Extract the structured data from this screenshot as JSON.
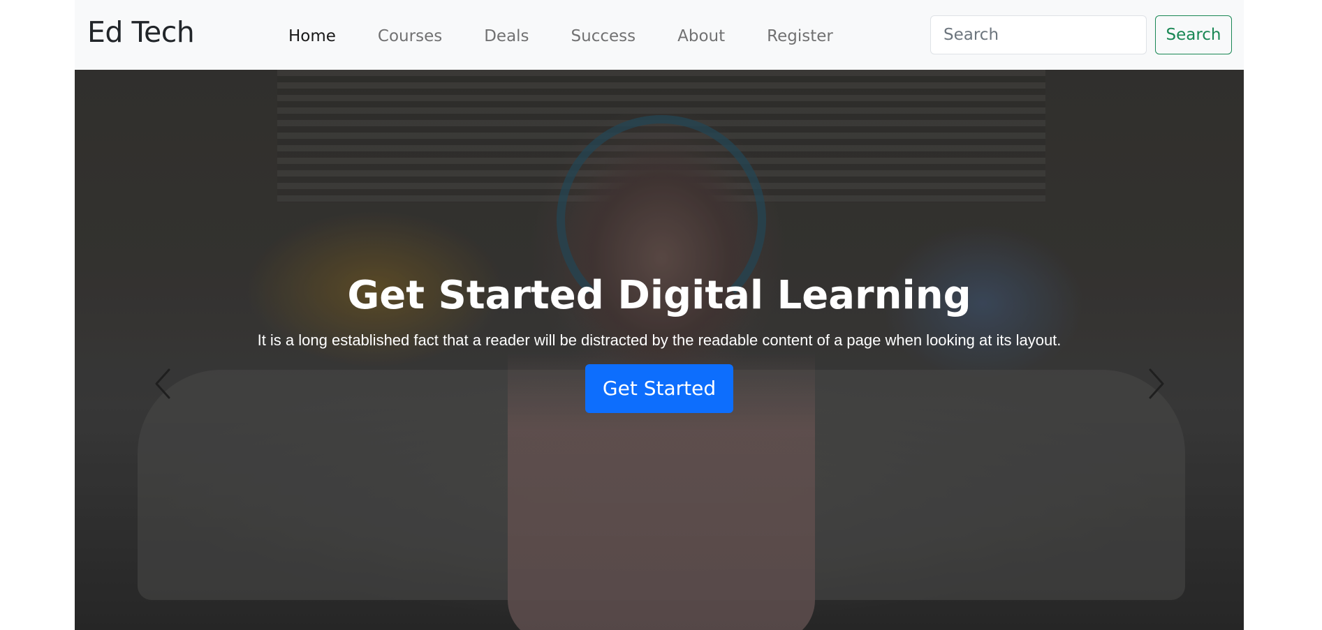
{
  "navbar": {
    "brand": "Ed Tech",
    "links": [
      {
        "label": "Home",
        "active": true
      },
      {
        "label": "Courses",
        "active": false
      },
      {
        "label": "Deals",
        "active": false
      },
      {
        "label": "Success",
        "active": false
      },
      {
        "label": "About",
        "active": false
      },
      {
        "label": "Register",
        "active": false
      }
    ],
    "search": {
      "placeholder": "Search",
      "button_label": "Search"
    }
  },
  "hero": {
    "title": "Get Started Digital Learning",
    "text": "It is a long established fact that a reader will be distracted by the readable content of a page when looking at its layout.",
    "button_label": "Get Started",
    "controls": {
      "prev_icon": "chevron-left-icon",
      "next_icon": "chevron-right-icon"
    }
  },
  "colors": {
    "navbar_bg": "#f8f9fa",
    "primary": "#0d6efd",
    "success": "#198754"
  }
}
